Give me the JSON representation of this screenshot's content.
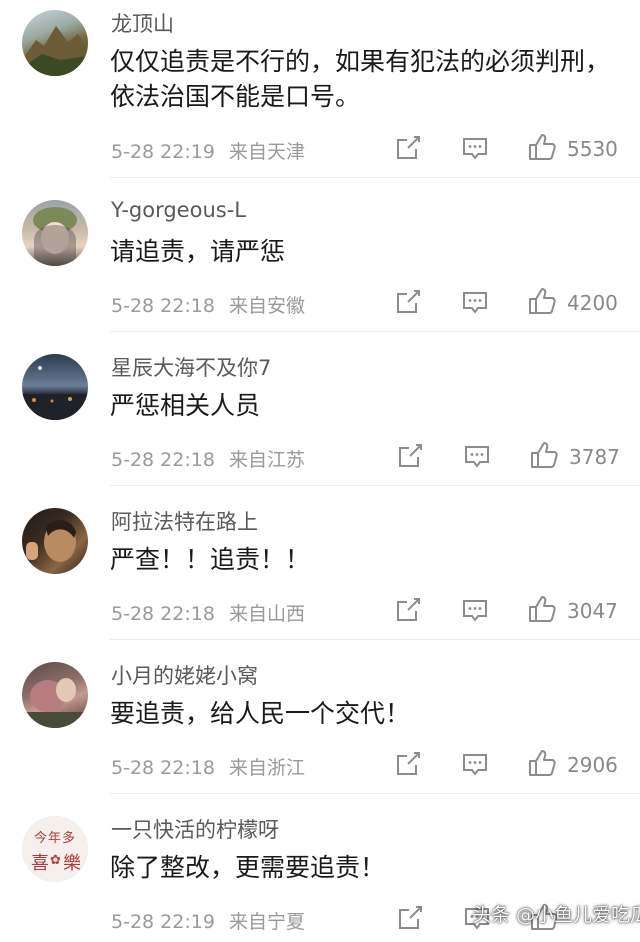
{
  "comments": [
    {
      "user": "龙顶山",
      "text": "仅仅追责是不行的，如果有犯法的必须判刑，依法治国不能是口号。",
      "time": "5-28 22:19",
      "loc": "来自天津",
      "likes": "5530"
    },
    {
      "user": "Y-gorgeous-L",
      "text": "请追责，请严惩",
      "time": "5-28 22:18",
      "loc": "来自安徽",
      "likes": "4200"
    },
    {
      "user": "星辰大海不及你7",
      "text": "严惩相关人员",
      "time": "5-28 22:18",
      "loc": "来自江苏",
      "likes": "3787"
    },
    {
      "user": "阿拉法特在路上",
      "text": "严查！！追责！！",
      "time": "5-28 22:18",
      "loc": "来自山西",
      "likes": "3047"
    },
    {
      "user": "小月的姥姥小窝",
      "text": "要追责，给人民一个交代！",
      "time": "5-28 22:18",
      "loc": "来自浙江",
      "likes": "2906"
    },
    {
      "user": "一只快活的柠檬呀",
      "text": "除了整改，更需要追责！",
      "time": "5-28 22:19",
      "loc": "来自宁夏",
      "likes": ""
    }
  ],
  "avatar6": {
    "line1": "今年多",
    "line2": "喜",
    "line3": "樂"
  },
  "icons": {
    "share": "share-icon",
    "reply": "comment-icon",
    "like": "thumbs-up-icon"
  },
  "watermark": "头条 @小鱼儿爱吃瓜"
}
